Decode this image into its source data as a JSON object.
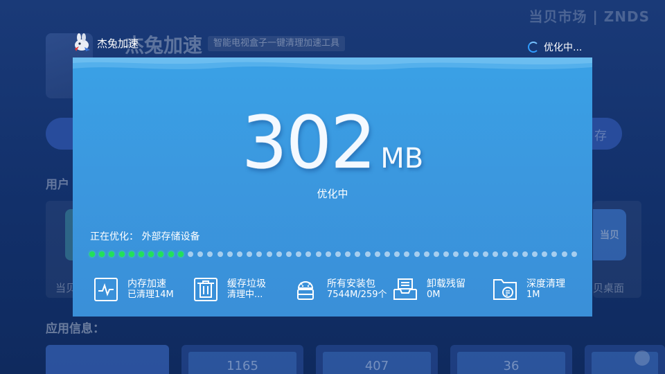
{
  "background": {
    "watermark": "当贝市场 | ZNDS",
    "app_title": "杰兔加速",
    "app_subtitle": "智能电视盒子一键清理加速工具",
    "pill_right_label": "存",
    "user_section_label": "用户",
    "left_item_label": "当贝",
    "right_item_label": "贝桌面",
    "right_card_label": "当贝",
    "app_info_label": "应用信息：",
    "tiles": [
      "",
      "1165",
      "407",
      "36",
      ""
    ]
  },
  "header": {
    "app_name": "杰兔加速",
    "status": "优化中..."
  },
  "optimizer": {
    "size_value": "302",
    "size_unit": "MB",
    "status": "优化中",
    "progress_label": "正在优化： 外部存储设备",
    "progress_total_dots": 50,
    "progress_done_dots": 10,
    "items": [
      {
        "icon": "memory-pulse-icon",
        "title": "内存加速",
        "detail": "已清理14M"
      },
      {
        "icon": "cache-trash-icon",
        "title": "缓存垃圾",
        "detail": "清理中..."
      },
      {
        "icon": "android-package-icon",
        "title": "所有安装包",
        "detail": "7544M/259个"
      },
      {
        "icon": "uninstall-residue-icon",
        "title": "卸载残留",
        "detail": "0M"
      },
      {
        "icon": "deep-clean-folder-icon",
        "title": "深度清理",
        "detail": "1M"
      }
    ]
  },
  "colors": {
    "modal_bg": "#3a98df",
    "progress_done": "#22e05a",
    "progress_todo": "#cfe6f8",
    "spinner": "#2f9cff"
  }
}
